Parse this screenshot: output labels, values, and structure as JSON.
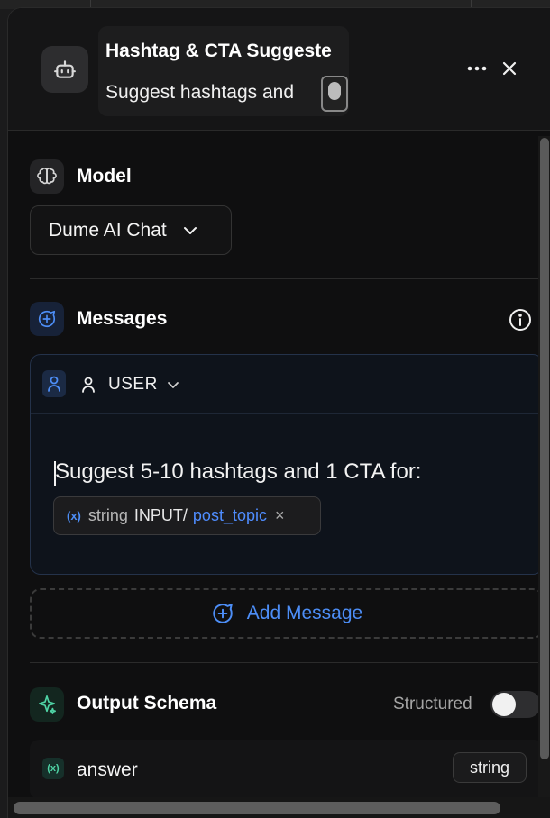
{
  "header": {
    "title": "Hashtag & CTA Suggeste",
    "subtitle": "Suggest hashtags and",
    "bot_icon": "bot-icon",
    "more_icon": "more-horizontal-icon",
    "close_icon": "close-icon"
  },
  "model": {
    "section_title": "Model",
    "icon": "brain-icon",
    "selected": "Dume AI Chat"
  },
  "messages": {
    "section_title": "Messages",
    "icon": "message-plus-icon",
    "info_icon": "info-icon",
    "items": [
      {
        "role": "USER",
        "text": "Suggest 5-10 hashtags and 1 CTA for:",
        "variable": {
          "type": "string",
          "path": "INPUT/",
          "name": "post_topic",
          "remove": "×"
        }
      }
    ],
    "add_label": "Add Message"
  },
  "output_schema": {
    "section_title": "Output Schema",
    "icon": "sparkle-icon",
    "toggle_label": "Structured",
    "toggle_on": false,
    "fields": [
      {
        "name": "answer",
        "type": "string"
      }
    ]
  },
  "colors": {
    "accent": "#4d8ef7",
    "panel_bg": "#0f0f10",
    "schema_icon": "#4fd3a5"
  }
}
